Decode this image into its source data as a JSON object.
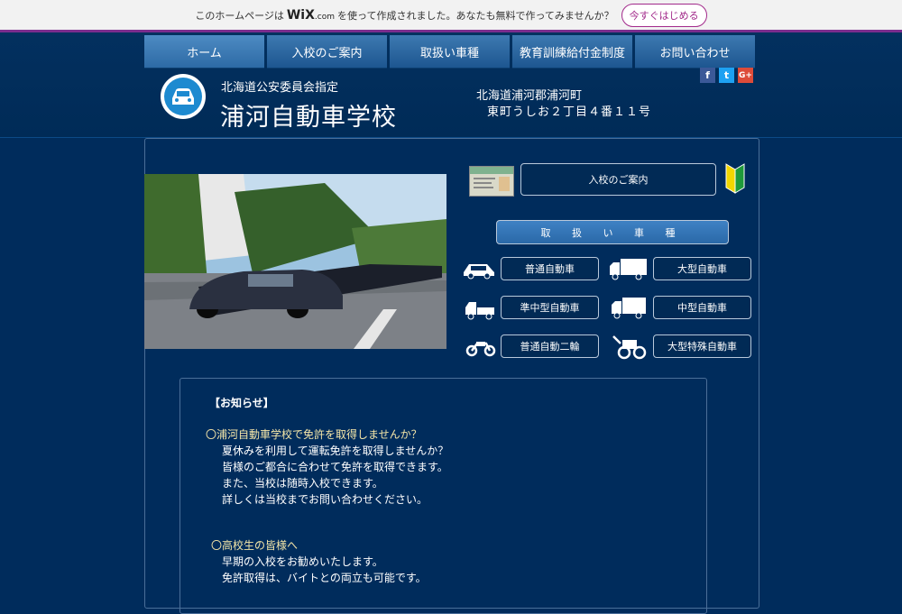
{
  "wix_banner": {
    "pre_text": "このホームページは",
    "logo_text": "WiX",
    "logo_suffix": ".com",
    "post_text": "を使って作成されました。あなたも無料で作ってみませんか？",
    "button_label": "今すぐはじめる"
  },
  "nav": {
    "items": [
      {
        "label": "ホーム"
      },
      {
        "label": "入校のご案内"
      },
      {
        "label": "取扱い車種"
      },
      {
        "label": "教育訓練給付金制度"
      },
      {
        "label": "お問い合わせ"
      }
    ]
  },
  "social": {
    "facebook": "f",
    "twitter": "t",
    "googleplus": "G+"
  },
  "header": {
    "subtitle": "北海道公安委員会指定",
    "title": "浦河自動車学校",
    "address_line1": "北海道浦河郡浦河町",
    "address_line2": "東町うしお２丁目４番１１号"
  },
  "main": {
    "entry_button": "入校のご案内",
    "types_button": "取 扱 い 車 種",
    "vehicles": [
      {
        "label": "普通自動車",
        "icon": "car-icon"
      },
      {
        "label": "大型自動車",
        "icon": "large-truck-icon"
      },
      {
        "label": "準中型自動車",
        "icon": "semi-medium-truck-icon"
      },
      {
        "label": "中型自動車",
        "icon": "medium-truck-icon"
      },
      {
        "label": "普通自動二輪",
        "icon": "motorcycle-icon"
      },
      {
        "label": "大型特殊自動車",
        "icon": "tractor-icon"
      }
    ]
  },
  "notice": {
    "title": "【お知らせ】",
    "lines": [
      "〇浦河自動車学校で免許を取得しませんか？",
      "夏休みを利用して運転免許を取得しませんか？",
      "皆様のご都合に合わせて免許を取得できます。",
      "また、当校は随時入校できます。",
      "詳しくは当校までお問い合わせください。",
      "〇高校生の皆様へ",
      "早期の入校をお勧めいたします。",
      "免許取得は、バイトとの両立も可能です。"
    ]
  },
  "colors": {
    "background": "#002c5c",
    "nav": "#2d6aa5",
    "accent": "#3f82c4",
    "notice_highlight": "#f5e6a8"
  }
}
